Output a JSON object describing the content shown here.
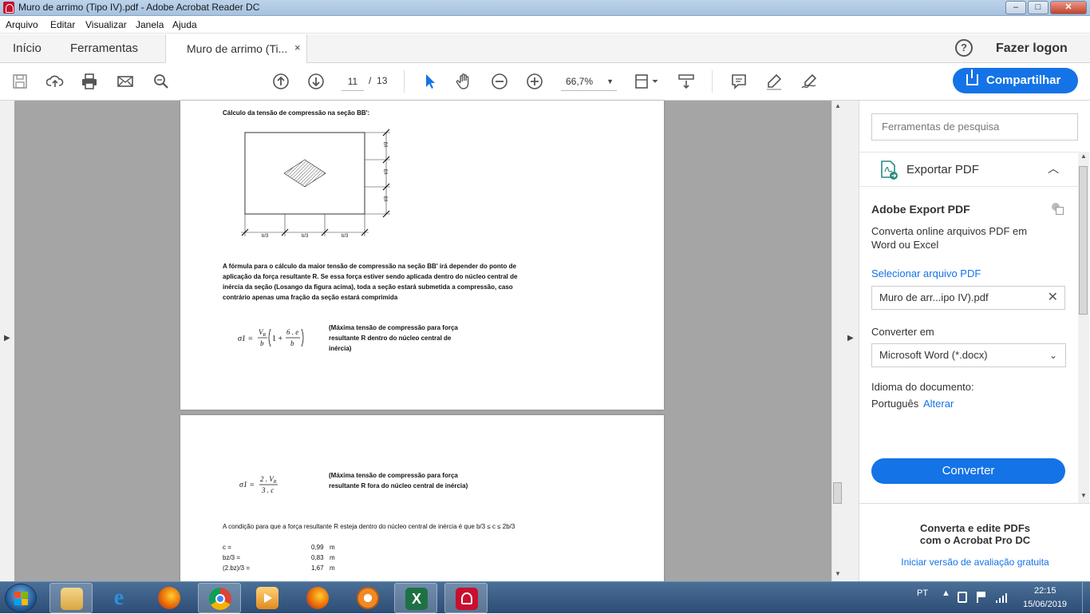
{
  "window": {
    "title": "Muro de arrimo (Tipo IV).pdf - Adobe Acrobat Reader DC",
    "controls": {
      "minimize": "–",
      "maximize": "□",
      "close": "✕"
    }
  },
  "menu": [
    "Arquivo",
    "Editar",
    "Visualizar",
    "Janela",
    "Ajuda"
  ],
  "tabs": {
    "home": "Início",
    "tools": "Ferramentas",
    "document": "Muro de arrimo (Ti...",
    "close": "×",
    "help": "?",
    "login": "Fazer logon"
  },
  "toolbar": {
    "page_current": "11",
    "page_sep": "/",
    "page_total": "13",
    "zoom": "66,7%",
    "share": "Compartilhar"
  },
  "document": {
    "page1": {
      "heading": "Cálculo da tensão de compressão na seção BB':",
      "side_labels": [
        "t/3",
        "t/3",
        "t/3"
      ],
      "bottom_labels": [
        "b/3",
        "b/3",
        "b/3"
      ],
      "paragraph": "A fórmula para o cálculo da maior tensão de compressão na seção BB' irá depender do ponto de aplicação da força resultante R. Se essa força estiver sendo aplicada dentro do núcleo central de inércia da seção (Losango da figura acima), toda a seção estará submetida a compressão, caso contrário apenas uma fração da seção estará comprimida",
      "formula": "σ1 = (V_R / b) (1 + 6.e / b)",
      "formula_note": "(Máxima tensão de compressão para força resultante R dentro do núcleo central de inércia)"
    },
    "page2": {
      "formula": "σ1 = 2.V_R / 3.c",
      "formula_note": "(Máxima tensão de compressão para força resultante R fora do núcleo central de inércia)",
      "condition": "A condição para que a força resultante R esteja dentro do núcleo central de inércia é que b/3 ≤ c ≤ 2b/3",
      "rows": [
        {
          "label": "c =",
          "value": "0,99",
          "unit": "m"
        },
        {
          "label": "bz/3 =",
          "value": "0,83",
          "unit": "m"
        },
        {
          "label": "(2.bz)/3 =",
          "value": "1,67",
          "unit": "m"
        }
      ]
    }
  },
  "right_panel": {
    "search_placeholder": "Ferramentas de pesquisa",
    "export_title": "Exportar PDF",
    "service_title": "Adobe Export PDF",
    "service_desc_1": "Converta online arquivos PDF em",
    "service_desc_2": "Word ou Excel",
    "select_file": "Selecionar arquivo PDF",
    "file_name": "Muro de arr...ipo IV).pdf",
    "convert_to_label": "Converter em",
    "convert_to_value": "Microsoft Word (*.docx)",
    "language_label": "Idioma do documento:",
    "language_value": "Português",
    "language_change": "Alterar",
    "convert_button": "Converter",
    "promo_1": "Converta e edite PDFs",
    "promo_2": "com o Acrobat Pro DC",
    "promo_link": "Iniciar versão de avaliação gratuita"
  },
  "taskbar": {
    "lang": "PT",
    "time": "22:15",
    "date": "15/06/2019"
  }
}
